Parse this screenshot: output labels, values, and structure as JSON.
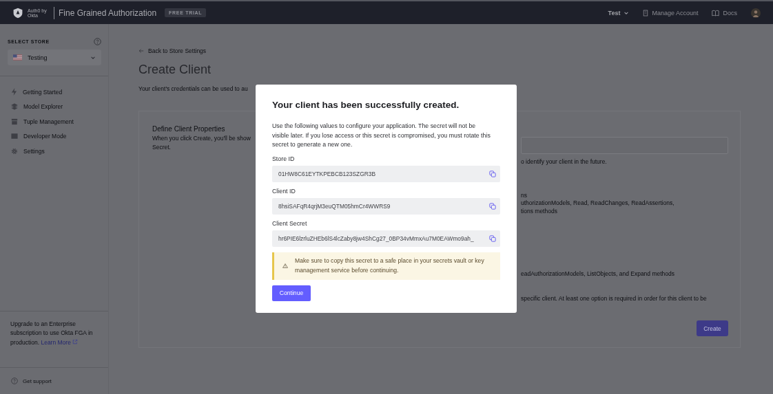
{
  "top_bar": {
    "brand": "Auth0 by Okta",
    "product": "Fine Grained Authorization",
    "badge": "FREE TRIAL",
    "store_menu": "Test",
    "manage_account": "Manage Account",
    "docs": "Docs"
  },
  "sidebar": {
    "section_label": "SELECT STORE",
    "store": "Testing",
    "items": [
      {
        "label": "Getting Started"
      },
      {
        "label": "Model Explorer"
      },
      {
        "label": "Tuple Management"
      },
      {
        "label": "Developer Mode"
      },
      {
        "label": "Settings"
      }
    ],
    "upgrade_text": "Upgrade to an Enterprise subscription to use Okta FGA in production.",
    "upgrade_link": "Learn More",
    "support": "Get support"
  },
  "page": {
    "back_link": "Back to Store Settings",
    "title": "Create Client",
    "subtitle": "Your client's credentials can be used to au",
    "card": {
      "title": "Define Client Properties",
      "description_lines": [
        "When you click Create, you'll be show",
        "Secret."
      ],
      "name_hint": "o identify your client in the future.",
      "permission_heading": "ns",
      "permission_lines": [
        "uthorizationModels, Read, ReadChanges, ReadAssertions,",
        "tions methods"
      ],
      "permission_2": "eadAuthorizationModels, ListObjects, and Expand methods",
      "note": "specific client. At least one option is required in order for this client to be",
      "create_button": "Create"
    }
  },
  "modal": {
    "title": "Your client has been successfully created.",
    "body": "Use the following values to configure your application. The secret will not be visible later. If you lose access or this secret is compromised, you must rotate this secret to generate a new one.",
    "fields": [
      {
        "label": "Store ID",
        "value": "01HW8C61EYTKPEBCB123SZGR3B"
      },
      {
        "label": "Client ID",
        "value": "8hsiSAFqR4qrjM3euQTM05hmCr4WWRS9"
      },
      {
        "label": "Client Secret",
        "value": "hr6PIE6lzrluZHEb6lS4lcZaby8jw4ShCg27_0BP34vMmxAu7M0EAWmo9ah_"
      }
    ],
    "warning": "Make sure to copy this secret to a safe place in your secrets vault or key management service before continuing.",
    "continue_button": "Continue"
  }
}
